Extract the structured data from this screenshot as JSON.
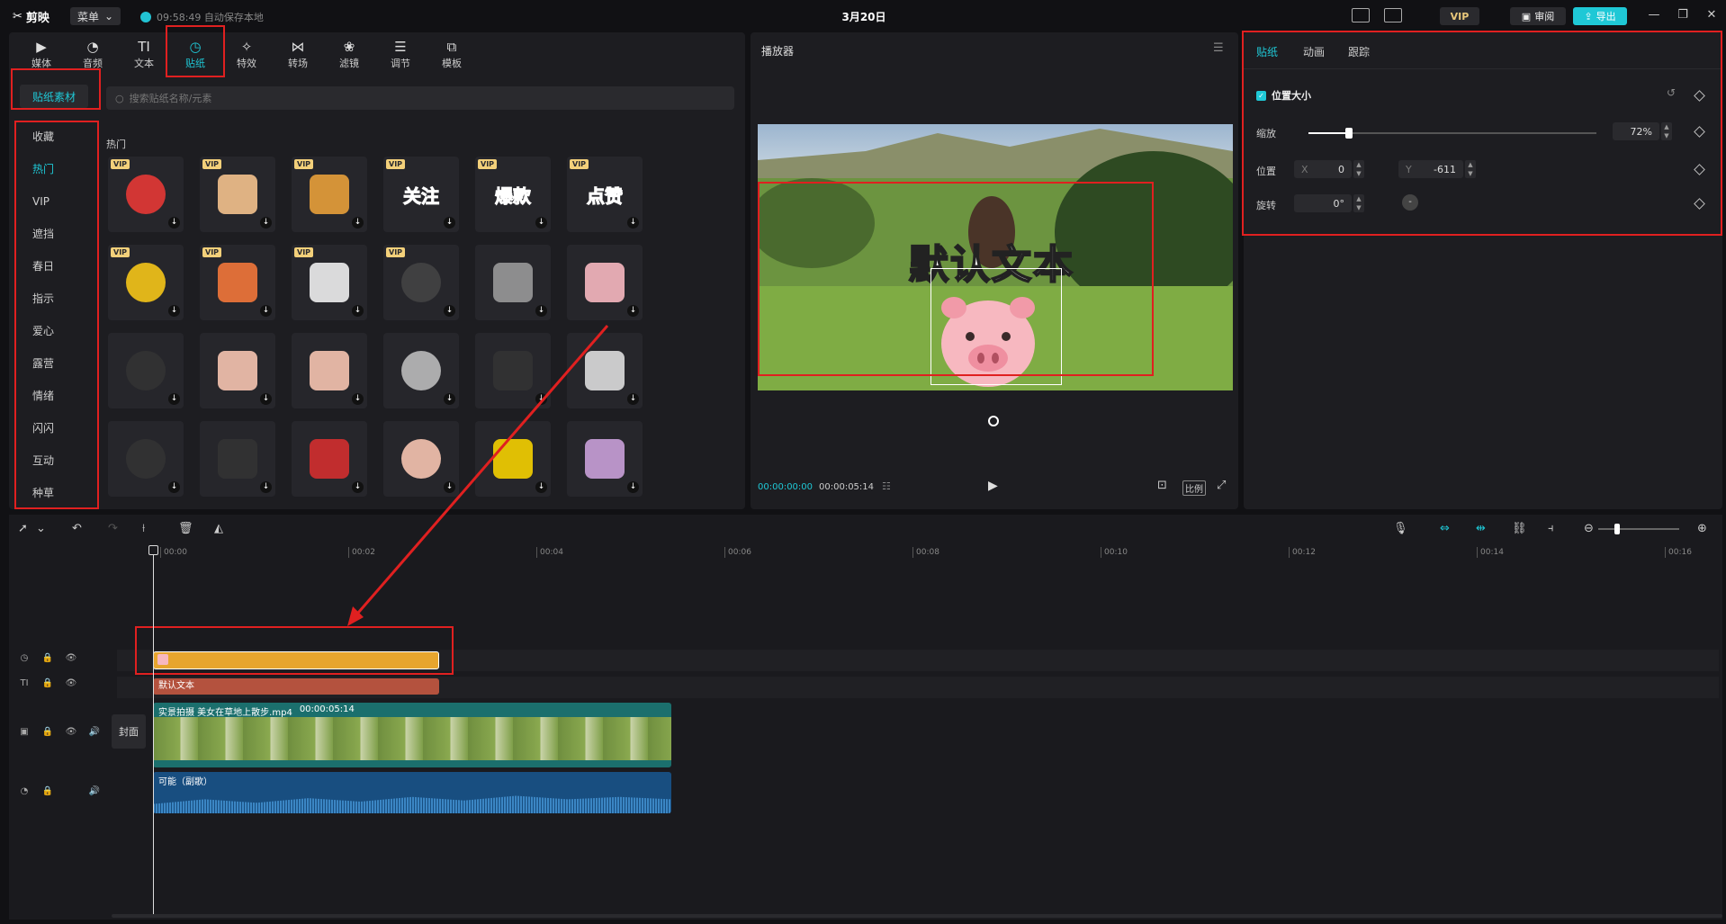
{
  "app": {
    "name": "剪映",
    "menu_label": "菜单",
    "autosave_text": "09:58:49 自动保存本地",
    "project_title": "3月20日",
    "vip_label": "VIP",
    "review_label": "审阅",
    "export_label": "导出"
  },
  "categories": [
    {
      "label": "媒体",
      "icon": "media-icon"
    },
    {
      "label": "音频",
      "icon": "audio-icon"
    },
    {
      "label": "文本",
      "icon": "text-icon"
    },
    {
      "label": "贴纸",
      "icon": "sticker-icon",
      "active": true
    },
    {
      "label": "特效",
      "icon": "effects-icon"
    },
    {
      "label": "转场",
      "icon": "transition-icon"
    },
    {
      "label": "滤镜",
      "icon": "filter-icon"
    },
    {
      "label": "调节",
      "icon": "adjust-icon"
    },
    {
      "label": "模板",
      "icon": "template-icon"
    }
  ],
  "sidebar": {
    "header": "贴纸素材",
    "items": [
      "收藏",
      "热门",
      "VIP",
      "遮挡",
      "春日",
      "指示",
      "爱心",
      "露营",
      "情绪",
      "闪闪",
      "互动",
      "种草"
    ],
    "active_index": 1
  },
  "search": {
    "placeholder": "搜索贴纸名称/元素"
  },
  "section": {
    "label": "热门"
  },
  "stickers": [
    {
      "name": "red-arrow-down",
      "vip": true
    },
    {
      "name": "pointing-hand",
      "vip": true
    },
    {
      "name": "colorful-text",
      "vip": true
    },
    {
      "name": "follow-text",
      "vip": true,
      "text": "关注"
    },
    {
      "name": "hot-sale-text",
      "vip": true,
      "text": "爆款"
    },
    {
      "name": "like-text",
      "vip": true,
      "text": "点赞"
    },
    {
      "name": "laughing-emoji",
      "vip": true
    },
    {
      "name": "megaphone",
      "vip": true
    },
    {
      "name": "cloud-puff",
      "vip": true
    },
    {
      "name": "question-marks",
      "vip": true
    },
    {
      "name": "mosaic-circle",
      "vip": false
    },
    {
      "name": "pig-face",
      "vip": false
    },
    {
      "name": "sparkle-dots",
      "vip": false
    },
    {
      "name": "thumbs-hand",
      "vip": false
    },
    {
      "name": "finger-heart",
      "vip": false
    },
    {
      "name": "mosaic-square",
      "vip": false
    },
    {
      "name": "stars-scatter",
      "vip": false
    },
    {
      "name": "sparkle-star",
      "vip": false
    },
    {
      "name": "starfield",
      "vip": false
    },
    {
      "name": "dots-field",
      "vip": false
    },
    {
      "name": "warning-arrow",
      "vip": false
    },
    {
      "name": "thumbs-up-hand",
      "vip": false
    },
    {
      "name": "yellow-star",
      "vip": false
    },
    {
      "name": "butterfly",
      "vip": false
    }
  ],
  "player": {
    "title": "播放器",
    "overlay_text": "默认文本",
    "current_time": "00:00:00:00",
    "total_time": "00:00:05:14",
    "ratio_label": "比例"
  },
  "properties": {
    "tabs": [
      "贴纸",
      "动画",
      "跟踪"
    ],
    "active_tab": 0,
    "section_label": "位置大小",
    "scale_label": "缩放",
    "scale_value": "72%",
    "scale_fraction": 0.14,
    "position_label": "位置",
    "pos_x_prefix": "X",
    "pos_x": "0",
    "pos_y_prefix": "Y",
    "pos_y": "-611",
    "rotation_label": "旋转",
    "rotation_value": "0°"
  },
  "timeline": {
    "ticks": [
      "00:00",
      "00:02",
      "00:04",
      "00:06",
      "00:08",
      "00:10",
      "00:12",
      "00:14",
      "00:16"
    ],
    "cover_label": "封面",
    "text_clip_label": "默认文本",
    "video_clip_name": "实景拍摄 美女在草地上散步.mp4",
    "video_clip_duration": "00:00:05:14",
    "audio_clip_name": "可能（副歌）"
  },
  "colors": {
    "accent": "#1fc8d6",
    "highlight": "#e02020",
    "sticker_clip": "#e7a52e",
    "text_clip": "#b4523e",
    "video_clip": "#1b6f6d",
    "audio_clip": "#184e80"
  }
}
